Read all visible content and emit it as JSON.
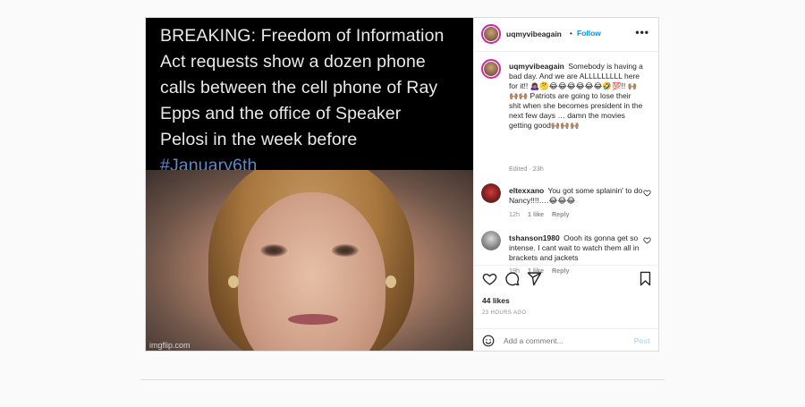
{
  "meme": {
    "lines": [
      "BREAKING: Freedom of Information",
      "Act requests show a dozen phone",
      "calls between the cell phone of Ray",
      "Epps and the office of Speaker",
      "Pelosi in the week before"
    ],
    "hashtag": "#January6th",
    "watermark": "imgflip.com"
  },
  "header": {
    "username": "uqmyvibeagain",
    "separator": "•",
    "follow_label": "Follow",
    "more_label": "•••"
  },
  "caption": {
    "username": "uqmyvibeagain",
    "text": "Somebody is having a bad day. And we are ALLLLLLLLL here for it!! 🙇🏽‍♀️🤔😂😂😂😂😂😂🤣💯!! 🙌🏽🙌🏽🙌🏽 Patriots are going to lose their shit when she becomes president in the next few days … damn the movies getting good🙌🏽🙌🏽🙌🏽",
    "meta": "Edited · 23h"
  },
  "comments": [
    {
      "username": "eltexxano",
      "text": "You got some splainin' to do Nancy!!!!….😂😂😂",
      "time": "12h",
      "likes": "1 like",
      "reply": "Reply"
    },
    {
      "username": "tshanson1980",
      "text": "Oooh its gonna get so intense. I cant wait to watch them all in brackets and jackets",
      "time": "19h",
      "likes": "1 like",
      "reply": "Reply"
    }
  ],
  "footer": {
    "likes": "44 likes",
    "timestamp": "23 HOURS AGO",
    "comment_placeholder": "Add a comment...",
    "post_label": "Post"
  },
  "colors": {
    "accent": "#0095f6",
    "post_disabled": "#b2dffc",
    "muted": "#8e8e8e",
    "ring": "#d6249f"
  }
}
